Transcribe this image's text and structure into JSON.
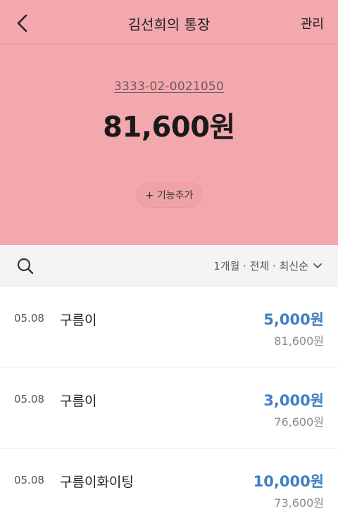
{
  "header": {
    "title": "김선희의 통장",
    "manage_label": "관리"
  },
  "account": {
    "number": "3333-02-0021050",
    "balance": "81,600원",
    "add_feature_label": "+ 기능추가"
  },
  "filter": {
    "label": "1개월 · 전체 · 최신순"
  },
  "colors": {
    "header_bg": "#f2a8ad",
    "amount_blue": "#3f7fc4"
  },
  "icons": [
    "chevron-left-icon",
    "search-icon",
    "chevron-down-icon"
  ],
  "transactions": [
    {
      "date": "05.08",
      "name": "구름이",
      "amount": "5,000원",
      "balance": "81,600원"
    },
    {
      "date": "05.08",
      "name": "구름이",
      "amount": "3,000원",
      "balance": "76,600원"
    },
    {
      "date": "05.08",
      "name": "구름이화이팅",
      "amount": "10,000원",
      "balance": "73,600원"
    }
  ]
}
